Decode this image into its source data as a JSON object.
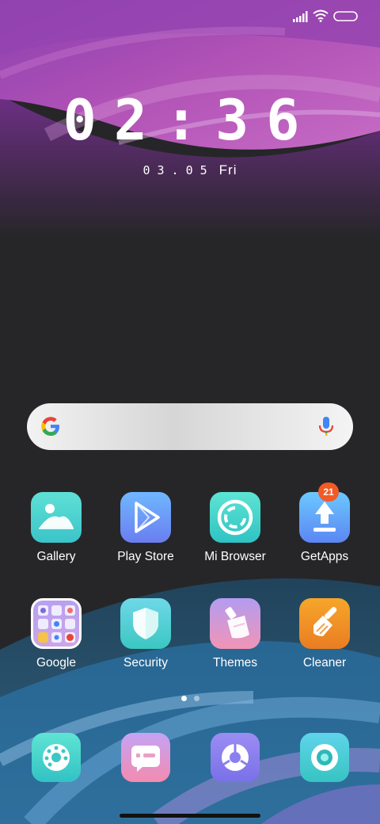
{
  "status_bar": {
    "signal_icon": "cellular-signal-icon",
    "wifi_icon": "wifi-icon",
    "battery_icon": "battery-icon"
  },
  "clock": {
    "time": "02:36",
    "date": "03.05",
    "day": "Fri"
  },
  "search_bar": {
    "logo_icon": "google-g-icon",
    "mic_icon": "microphone-icon"
  },
  "apps_row1": [
    {
      "label": "Gallery",
      "icon": "gallery-icon",
      "color_top": "#5fe0d6",
      "color_bottom": "#3bc4c9"
    },
    {
      "label": "Play Store",
      "icon": "play-store-icon",
      "color_top": "#6fb7ff",
      "color_bottom": "#6a7ef0"
    },
    {
      "label": "Mi Browser",
      "icon": "mi-browser-icon",
      "color_top": "#5de4d4",
      "color_bottom": "#2fc3c3"
    },
    {
      "label": "GetApps",
      "icon": "getapps-icon",
      "color_top": "#6cc8ff",
      "color_bottom": "#5b86f3",
      "badge": "21"
    }
  ],
  "apps_row2": [
    {
      "label": "Google",
      "icon": "google-folder-icon"
    },
    {
      "label": "Security",
      "icon": "security-shield-icon",
      "color_top": "#6fd8e8",
      "color_bottom": "#3bc7c2"
    },
    {
      "label": "Themes",
      "icon": "themes-brush-icon",
      "color_top": "#b39cf0",
      "color_bottom": "#f294b6"
    },
    {
      "label": "Cleaner",
      "icon": "cleaner-brush-icon",
      "color_top": "#f6a62a",
      "color_bottom": "#ea7d22"
    }
  ],
  "page_indicator": {
    "count": 2,
    "active": 0
  },
  "dock": [
    {
      "icon": "phone-dialer-icon",
      "color_top": "#5fe4d4",
      "color_bottom": "#32c2c4"
    },
    {
      "icon": "messaging-icon",
      "color_top": "#c4a3f5",
      "color_bottom": "#f48bb0"
    },
    {
      "icon": "chrome-browser-icon",
      "color_top": "#9b8df3",
      "color_bottom": "#7a70e8"
    },
    {
      "icon": "camera-icon",
      "color_top": "#5fd4ea",
      "color_bottom": "#37c4c2"
    }
  ],
  "colors": {
    "background": "#262628",
    "wallpaper_top": "#a84fb3",
    "badge": "#f25a26"
  }
}
